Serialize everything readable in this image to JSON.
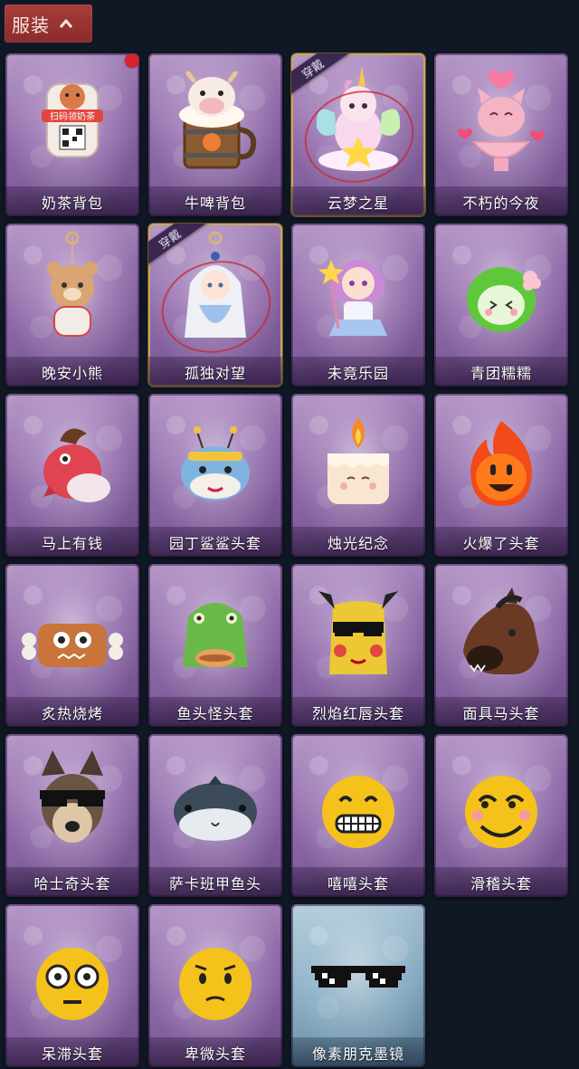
{
  "section": {
    "title": "服装",
    "expanded": true
  },
  "equipped_badge": "穿戴",
  "items": [
    {
      "name": "奶茶背包",
      "icon": "milk-tea-backpack-icon",
      "equipped": false,
      "new": true,
      "art_text": "扫码领奶茶"
    },
    {
      "name": "牛啤背包",
      "icon": "cow-beer-backpack-icon",
      "equipped": false,
      "new": false
    },
    {
      "name": "云梦之星",
      "icon": "unicorn-star-cloud-icon",
      "equipped": true,
      "new": false
    },
    {
      "name": "不朽的今夜",
      "icon": "pink-cat-heart-icon",
      "equipped": false,
      "new": false
    },
    {
      "name": "晚安小熊",
      "icon": "sleepy-bear-charm-icon",
      "equipped": false,
      "new": false
    },
    {
      "name": "孤独对望",
      "icon": "white-hair-doll-charm-icon",
      "equipped": true,
      "new": false
    },
    {
      "name": "未竟乐园",
      "icon": "magical-girl-figure-icon",
      "equipped": false,
      "new": false
    },
    {
      "name": "青团糯糯",
      "icon": "green-rice-ball-icon",
      "equipped": false,
      "new": false
    },
    {
      "name": "马上有钱",
      "icon": "red-horse-head-icon",
      "equipped": false,
      "new": false
    },
    {
      "name": "园丁鲨鲨头套",
      "icon": "shark-bee-head-icon",
      "equipped": false,
      "new": false
    },
    {
      "name": "烛光纪念",
      "icon": "candle-head-icon",
      "equipped": false,
      "new": false
    },
    {
      "name": "火爆了头套",
      "icon": "fire-head-icon",
      "equipped": false,
      "new": false
    },
    {
      "name": "炙热烧烤",
      "icon": "meat-bone-head-icon",
      "equipped": false,
      "new": false
    },
    {
      "name": "鱼头怪头套",
      "icon": "fish-monster-head-icon",
      "equipped": false,
      "new": false
    },
    {
      "name": "烈焰红唇头套",
      "icon": "yellow-pikachu-sunglasses-icon",
      "equipped": false,
      "new": false
    },
    {
      "name": "面具马头套",
      "icon": "horse-mask-icon",
      "equipped": false,
      "new": false
    },
    {
      "name": "哈士奇头套",
      "icon": "husky-sunglasses-head-icon",
      "equipped": false,
      "new": false
    },
    {
      "name": "萨卡班甲鱼头",
      "icon": "sacabambaspis-fish-head-icon",
      "equipped": false,
      "new": false
    },
    {
      "name": "嘻嘻头套",
      "icon": "grinning-emoji-head-icon",
      "equipped": false,
      "new": false
    },
    {
      "name": "滑稽头套",
      "icon": "funny-emoji-head-icon",
      "equipped": false,
      "new": false
    },
    {
      "name": "呆滞头套",
      "icon": "dazed-emoji-head-icon",
      "equipped": false,
      "new": false
    },
    {
      "name": "卑微头套",
      "icon": "humble-emoji-head-icon",
      "equipped": false,
      "new": false
    },
    {
      "name": "像素朋克墨镜",
      "icon": "pixel-sunglasses-icon",
      "equipped": false,
      "new": false,
      "theme": "blue"
    }
  ]
}
